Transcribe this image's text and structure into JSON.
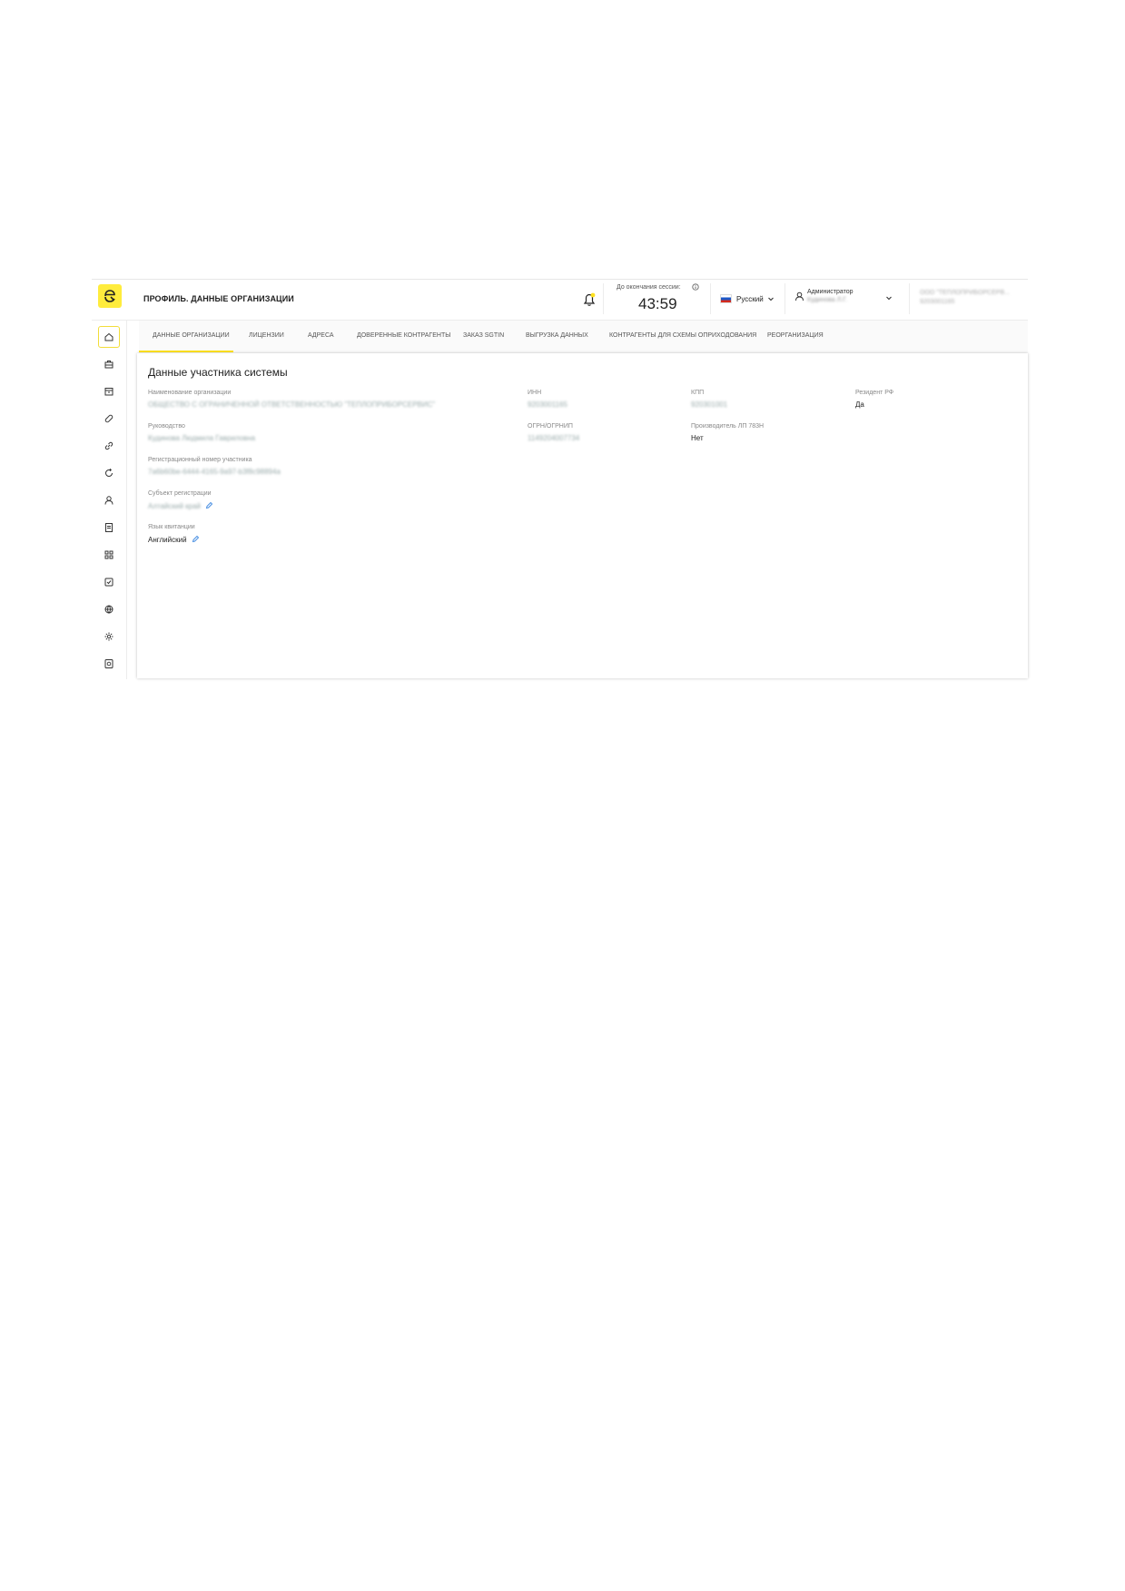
{
  "header": {
    "title": "ПРОФИЛЬ. ДАННЫЕ ОРГАНИЗАЦИИ",
    "session_label": "До окончания сессии:",
    "session_time": "43:59",
    "language": "Русский",
    "user_role": "Администратор",
    "user_name": "Кудинова Л.Г.",
    "org_name": "ООО \"ТЕПЛОПРИБОРСЕРВ...",
    "org_id": "9203001165"
  },
  "sidebar": {
    "items": [
      "home-icon",
      "briefcase-icon",
      "box-icon",
      "pills-icon",
      "link-icon",
      "recycle-icon",
      "user-icon",
      "document-icon",
      "qr-icon",
      "check-icon",
      "globe-icon",
      "gear-icon",
      "shield-icon"
    ]
  },
  "tabs": [
    {
      "label": "ДАННЫЕ ОРГАНИЗАЦИИ",
      "active": true
    },
    {
      "label": "ЛИЦЕНЗИИ"
    },
    {
      "label": "АДРЕСА"
    },
    {
      "label": "ДОВЕРЕННЫЕ КОНТРАГЕНТЫ"
    },
    {
      "label": "ЗАКАЗ SGTIN"
    },
    {
      "label": "ВЫГРУЗКА ДАННЫХ"
    },
    {
      "label": "КОНТРАГЕНТЫ ДЛЯ СХЕМЫ ОПРИХОДОВАНИЯ"
    },
    {
      "label": "РЕОРГАНИЗАЦИЯ"
    }
  ],
  "content": {
    "section_title": "Данные участника системы",
    "fields": {
      "org_name": {
        "label": "Наименование организации",
        "value": "ОБЩЕСТВО С ОГРАНИЧЕННОЙ ОТВЕТСТВЕННОСТЬЮ \"ТЕПЛОПРИБОРСЕРВИС\""
      },
      "inn": {
        "label": "ИНН",
        "value": "9203001165"
      },
      "kpp": {
        "label": "КПП",
        "value": "920301001"
      },
      "resident": {
        "label": "Резидент РФ",
        "value": "Да"
      },
      "head": {
        "label": "Руководство",
        "value": "Кудинова Людмила Гавриловна"
      },
      "ogrn": {
        "label": "ОГРН/ОГРНИП",
        "value": "1149204007734"
      },
      "producer": {
        "label": "Производитель ЛП 783Н",
        "value": "Нет"
      },
      "reg_number": {
        "label": "Регистрационный номер участника",
        "value": "7a6b60be-6444-4165-9a97-b3f8c98894a"
      },
      "region": {
        "label": "Субъект регистрации",
        "value": "Алтайский край"
      },
      "receipt_lang": {
        "label": "Язык квитанции",
        "value": "Английский"
      }
    }
  },
  "colors": {
    "accent": "#ffec3d",
    "edit": "#4a90e2"
  }
}
